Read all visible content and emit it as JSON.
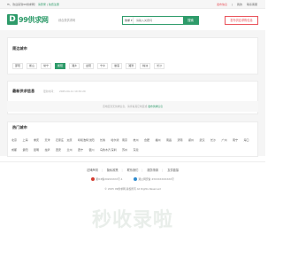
{
  "topbar": {
    "greeting": "Hi，欢迎来到99供求网！",
    "login_link": "请登录",
    "register_link": "免费注册",
    "actions": [
      "发布信息",
      "|",
      "我的",
      "联系客服"
    ],
    "highlight": "发布信息"
  },
  "header": {
    "logo_letter": "D",
    "logo_text": "99供求网",
    "slogan": "综合类供求网",
    "search": {
      "category": "供求",
      "placeholder": "请输入关键词",
      "button": "搜索"
    },
    "publish_button": "发布供应求购信息"
  },
  "nearby_cities": {
    "title": "周边城市",
    "tags": [
      "邵阳",
      "衡山",
      "常宁",
      "衡阳",
      "湘乡",
      "益阳",
      "宁乡",
      "娄底",
      "湘潭",
      "株洲",
      "长沙"
    ],
    "active_index": 3
  },
  "latest": {
    "title": "最新供求信息",
    "subtitle": "更新时间：",
    "date": "2025-04-11 10:32:20",
    "empty_text": "该地区暂无供求信息，请查看其它地区或",
    "empty_link": "发布供求信息"
  },
  "hot_cities": {
    "title": "热门城市",
    "rows": [
      [
        "北京",
        "上海",
        "重庆",
        "天津",
        "石家庄",
        "太原",
        "呼和浩特",
        "沈阳",
        "长春",
        "哈尔滨",
        "南京",
        "杭州",
        "合肥",
        "福州",
        "南昌",
        "济南",
        "郑州",
        "武汉",
        "长沙",
        "广州",
        "南宁",
        "海口"
      ],
      [
        "成都",
        "贵阳",
        "昆明",
        "拉萨",
        "西安",
        "兰州",
        "西宁",
        "银川",
        "乌鲁木齐",
        "深圳",
        "苏州",
        "东莞"
      ]
    ]
  },
  "footer": {
    "links": [
      "法律声明",
      "隐私政策",
      "联系我们",
      "服务条款",
      "友情链接"
    ],
    "filing_icp": "湘ICP备2022XXXX号-1",
    "filing_police": "湘公网安备 43XXXXXXXXXX号",
    "copyright": "© 2025 99供求网 版权所有 All Rights Reserved"
  },
  "watermark": "秒收录啦",
  "colors": {
    "brand_green": "#2e9b6a",
    "accent_red": "#e9525a",
    "gray_band": "#f5f5f5"
  }
}
